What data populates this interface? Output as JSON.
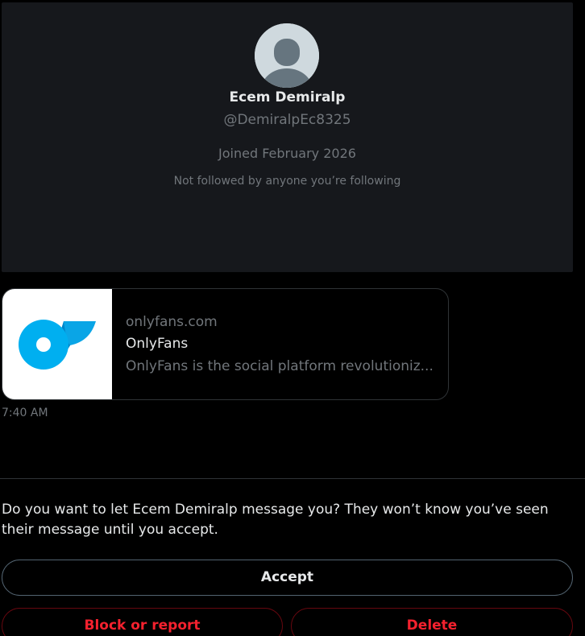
{
  "profile": {
    "name": "Ecem Demiralp",
    "handle": "@DemiralpEc8325",
    "joined": "Joined February 2026",
    "followers_note": "Not followed by anyone you’re following"
  },
  "link_card": {
    "domain": "onlyfans.com",
    "title": "OnlyFans",
    "description": "OnlyFans is the social platform revolutioniz...",
    "thumb_icon": "onlyfans-logo-icon"
  },
  "message": {
    "time": "7:40 AM"
  },
  "request": {
    "prompt": "Do you want to let Ecem Demiralp message you? They won’t know you’ve seen their message until you accept.",
    "accept_label": "Accept",
    "block_label": "Block or report",
    "delete_label": "Delete"
  },
  "colors": {
    "background": "#000000",
    "card": "#16181c",
    "muted_text": "#71767b",
    "primary_text": "#e7e9ea",
    "danger": "#f4212e",
    "onlyfans_blue": "#00aff0"
  }
}
